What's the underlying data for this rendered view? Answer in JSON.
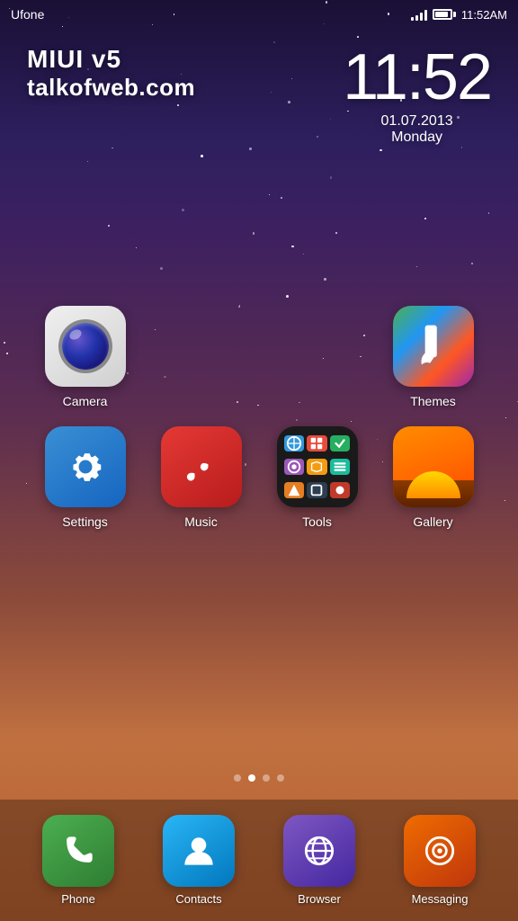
{
  "statusBar": {
    "carrier": "Ufone",
    "time": "11:52AM"
  },
  "header": {
    "brandLine1": "MIUI v5",
    "brandLine2": "talkofweb.com",
    "clockTime": "11:52",
    "clockDate": "01.07.2013",
    "clockDay": "Monday"
  },
  "apps": [
    {
      "id": "camera",
      "label": "Camera",
      "type": "camera"
    },
    {
      "id": "themes",
      "label": "Themes",
      "type": "themes"
    },
    {
      "id": "settings",
      "label": "Settings",
      "type": "settings"
    },
    {
      "id": "music",
      "label": "Music",
      "type": "music"
    },
    {
      "id": "tools",
      "label": "Tools",
      "type": "tools"
    },
    {
      "id": "gallery",
      "label": "Gallery",
      "type": "gallery"
    }
  ],
  "pageDots": [
    {
      "active": false
    },
    {
      "active": true
    },
    {
      "active": false
    },
    {
      "active": false
    }
  ],
  "dock": [
    {
      "id": "phone",
      "label": "Phone",
      "type": "phone"
    },
    {
      "id": "contacts",
      "label": "Contacts",
      "type": "contacts"
    },
    {
      "id": "browser",
      "label": "Browser",
      "type": "browser"
    },
    {
      "id": "messaging",
      "label": "Messaging",
      "type": "messaging"
    }
  ]
}
